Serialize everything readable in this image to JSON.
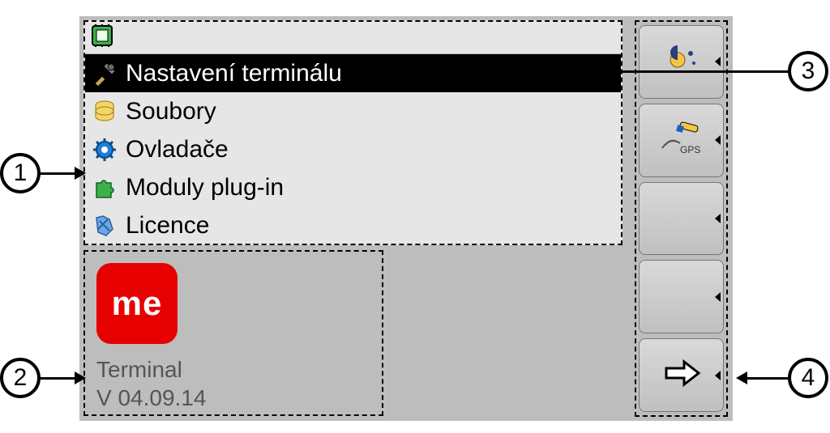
{
  "menu": {
    "items": [
      {
        "label": "Nastavení terminálu",
        "icon": "tools-icon",
        "selected": true
      },
      {
        "label": "Soubory",
        "icon": "database-icon",
        "selected": false
      },
      {
        "label": "Ovladače",
        "icon": "gear-icon",
        "selected": false
      },
      {
        "label": "Moduly plug-in",
        "icon": "puzzle-icon",
        "selected": false
      },
      {
        "label": "Licence",
        "icon": "license-icon",
        "selected": false
      }
    ]
  },
  "info": {
    "logo_text": "me",
    "product_name": "Terminal",
    "version": "V 04.09.14"
  },
  "softkeys": [
    {
      "name": "brightness-button",
      "icon": "sun-icon"
    },
    {
      "name": "gps-button",
      "icon": "gps-icon",
      "caption": "GPS"
    },
    {
      "name": "blank-button-1",
      "icon": ""
    },
    {
      "name": "blank-button-2",
      "icon": ""
    },
    {
      "name": "next-button",
      "icon": "arrow-right-icon"
    }
  ],
  "callouts": {
    "c1": "1",
    "c2": "2",
    "c3": "3",
    "c4": "4"
  }
}
